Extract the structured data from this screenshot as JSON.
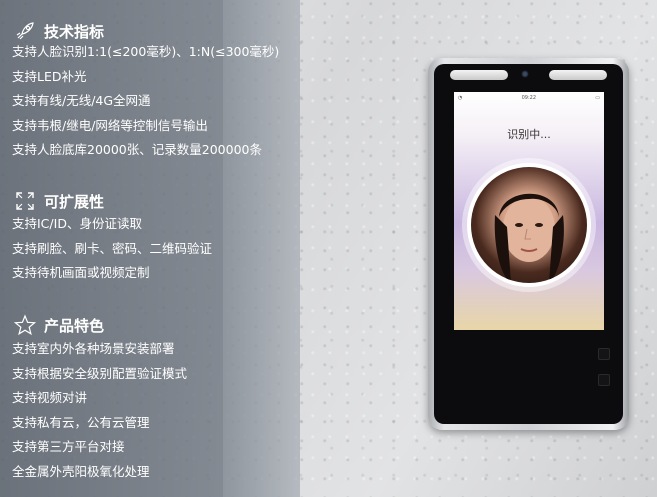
{
  "sections": [
    {
      "icon": "rocket-icon",
      "title": "技术指标",
      "items": [
        "支持人脸识别1:1(≤200毫秒)、1:N(≤300毫秒)",
        "支持LED补光",
        "支持有线/无线/4G全网通",
        "支持韦根/继电/网络等控制信号输出",
        "支持人脸底库20000张、记录数量200000条"
      ]
    },
    {
      "icon": "expand-icon",
      "title": "可扩展性",
      "items": [
        "支持IC/ID、身份证读取",
        "支持刷脸、刷卡、密码、二维码验证",
        "支持待机画面或视频定制"
      ]
    },
    {
      "icon": "star-icon",
      "title": "产品特色",
      "items": [
        "支持室内外各种场景安装部署",
        "支持根据安全级别配置验证模式",
        "支持视频对讲",
        "支持私有云，公有云管理",
        "支持第三方平台对接",
        "全金属外壳阳极氧化处理"
      ]
    }
  ],
  "device": {
    "status_time": "09:22",
    "recognizing_text": "识别中..."
  }
}
